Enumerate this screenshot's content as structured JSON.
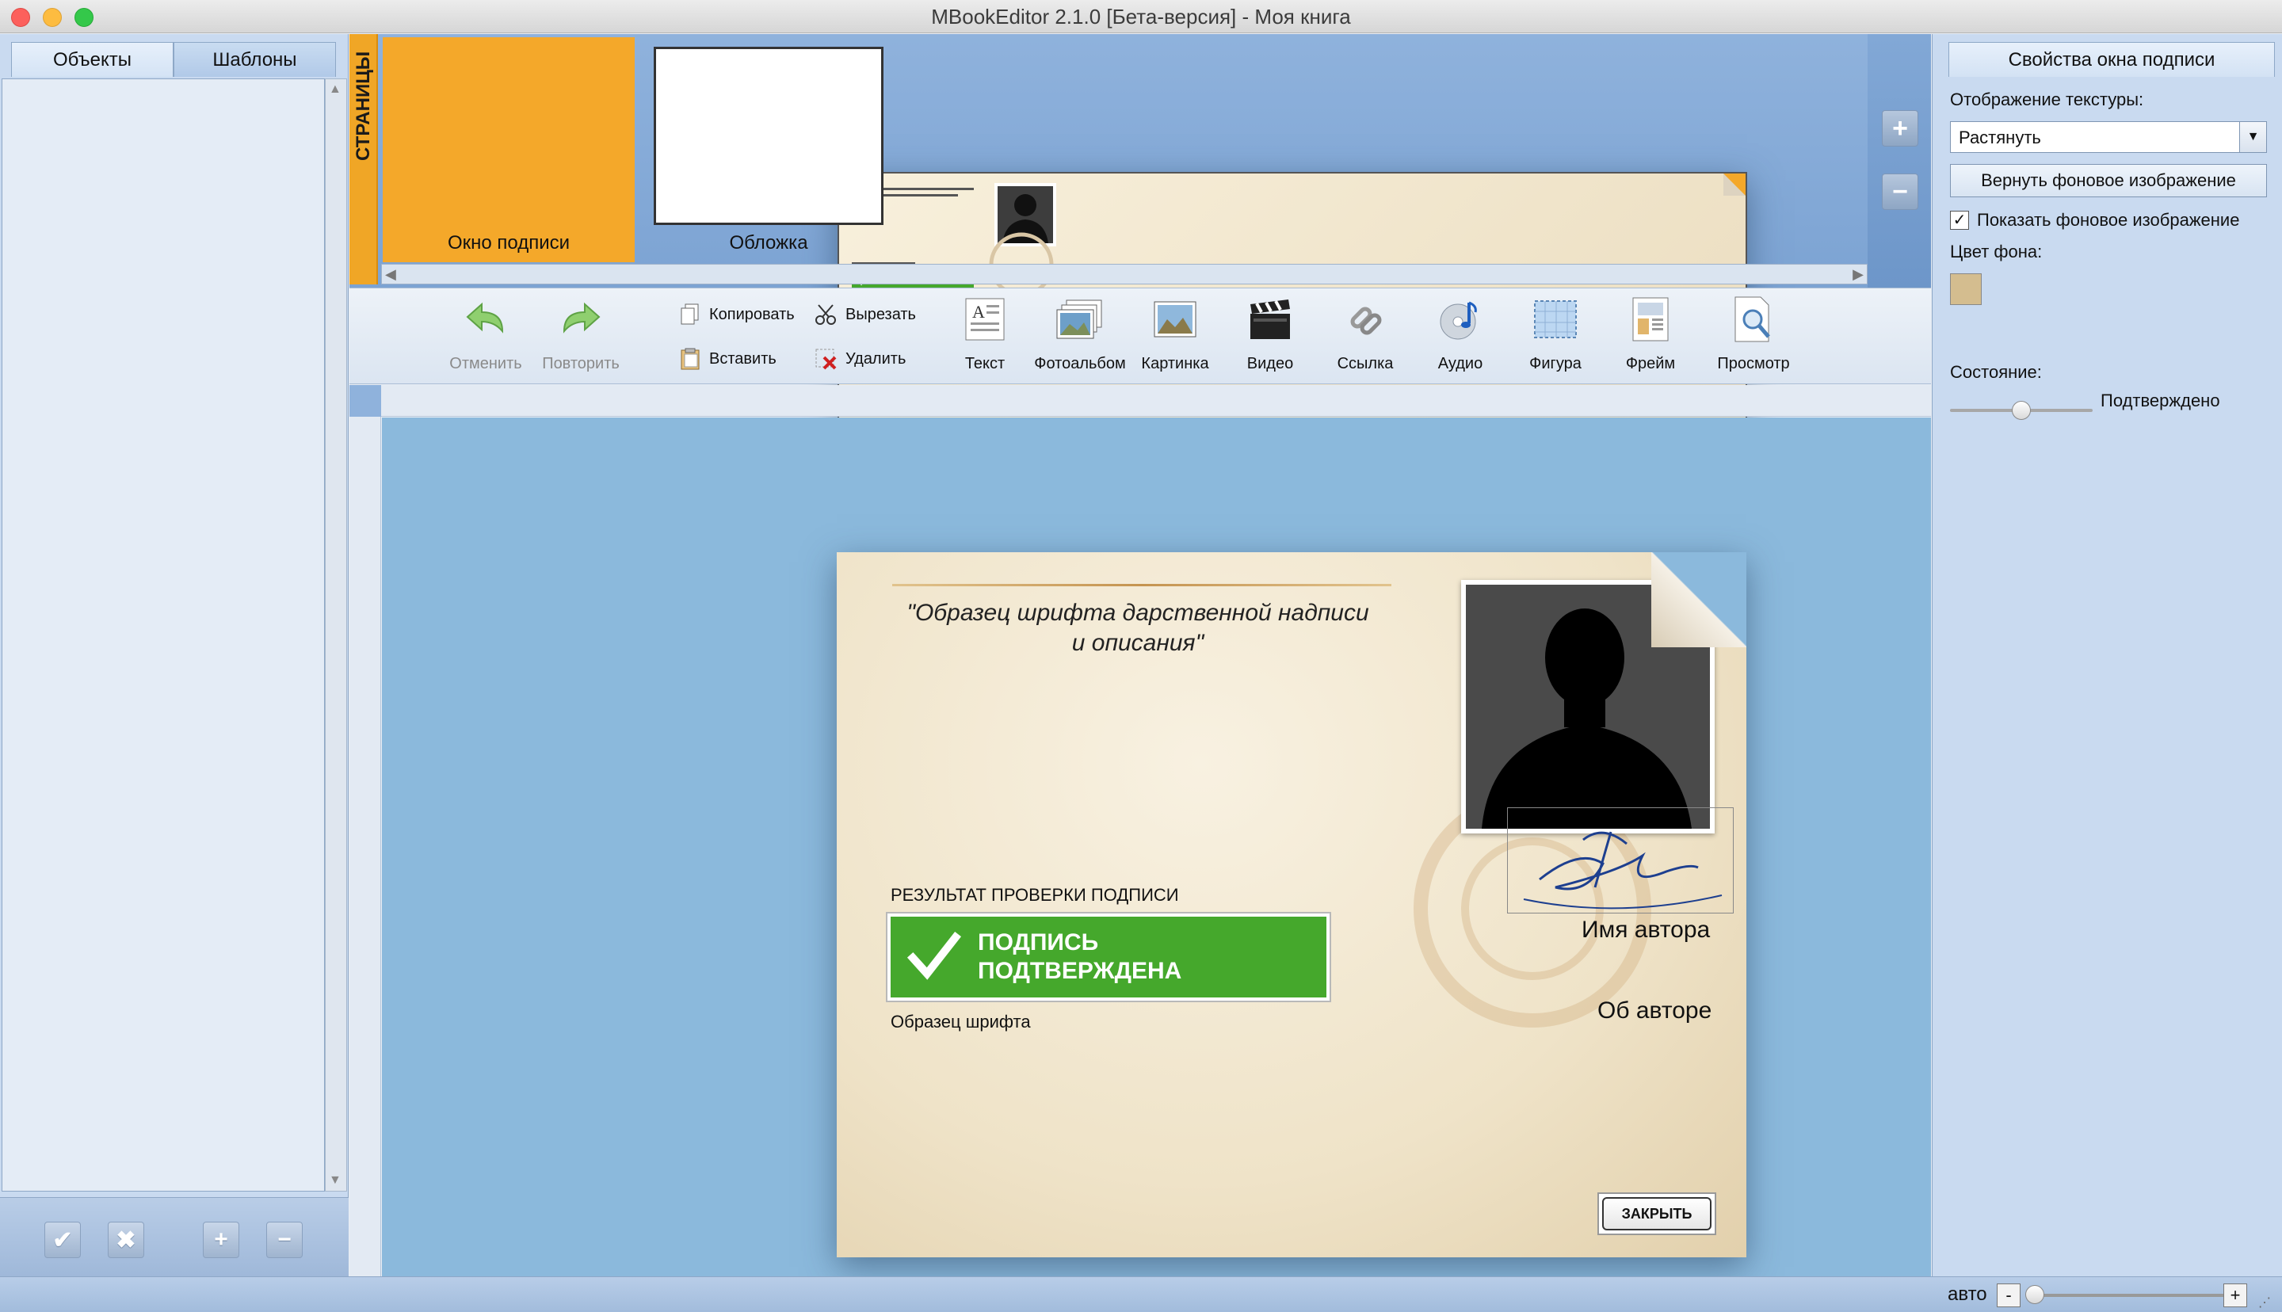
{
  "window": {
    "title": "MBookEditor 2.1.0 [Бета-версия] - Моя книга"
  },
  "left_panel": {
    "tabs": [
      {
        "label": "Объекты"
      },
      {
        "label": "Шаблоны"
      }
    ]
  },
  "pages": {
    "label": "СТРАНИЦЫ",
    "items": [
      {
        "label": "Окно подписи",
        "selected": true
      },
      {
        "label": "Обложка",
        "selected": false
      }
    ]
  },
  "toolbar": {
    "undo": "Отменить",
    "redo": "Повторить",
    "copy": "Копировать",
    "paste": "Вставить",
    "cut": "Вырезать",
    "delete": "Удалить",
    "text": "Текст",
    "photoalbum": "Фотоальбом",
    "picture": "Картинка",
    "video": "Видео",
    "link": "Ссылка",
    "audio": "Аудио",
    "shape": "Фигура",
    "frame": "Фрейм",
    "preview": "Просмотр"
  },
  "canvas": {
    "caption": "\"Образец шрифта дарственной надписи и описания\"",
    "result_label": "РЕЗУЛЬТАТ ПРОВЕРКИ ПОДПИСИ",
    "verify_text": "ПОДПИСЬ\nПОДТВЕРЖДЕНА",
    "font_sample": "Образец шрифта",
    "author_name": "Имя автора",
    "author_about": "Об авторе",
    "close_button": "ЗАКРЫТЬ"
  },
  "right_panel": {
    "header": "Свойства окна подписи",
    "texture_label": "Отображение текстуры:",
    "texture_value": "Растянуть",
    "reset_background_button": "Вернуть фоновое изображение",
    "show_background_label": "Показать фоновое изображение",
    "show_background_checked": true,
    "bg_color_label": "Цвет фона:",
    "bg_color": "#d4bd8f",
    "state_label": "Состояние:",
    "state_value": "Подтверждено",
    "state_level": 0.5
  },
  "statusbar": {
    "zoom_label": "авто"
  },
  "colors": {
    "accent_orange": "#f0a626",
    "verify_green": "#45a82c",
    "canvas_blue": "#8bb9dc"
  }
}
